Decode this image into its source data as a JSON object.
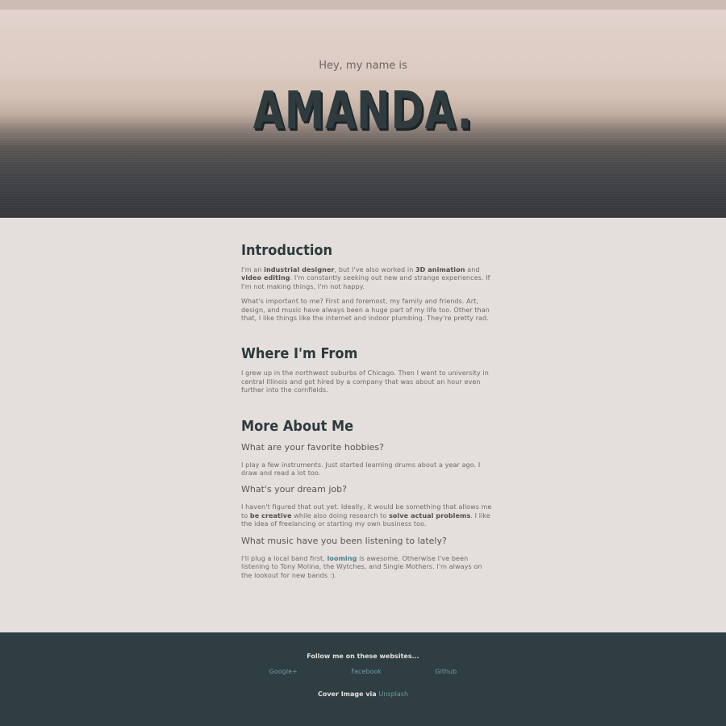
{
  "hero": {
    "greeting": "Hey, my name is",
    "name": "AMANDA."
  },
  "intro": {
    "title": "Introduction",
    "p1": {
      "t1": "I'm an ",
      "b1": "industrial designer",
      "t2": ", but I've also worked in ",
      "b2": "3D animation",
      "t3": " and ",
      "b3": "video editing",
      "t4": ". I'm constantly seeking out new and strange experiences. If I'm not making things, I'm not happy."
    },
    "p2": "What's important to me? First and foremost, my family and friends. Art, design, and music have always been a huge part of my life too. Other than that, I like things like the internet and indoor plumbing. They're pretty rad."
  },
  "from": {
    "title": "Where I'm From",
    "p1": "I grew up in the northwest suburbs of Chicago. Then I went to university in central Illinois and got hired by a company that was about an hour even further into the cornfields."
  },
  "more": {
    "title": "More About Me",
    "q1": "What are your favorite hobbies?",
    "a1": "I play a few instruments. Just started learning drums about a year ago. I draw and read a lot too.",
    "q2": "What's your dream job?",
    "a2": {
      "t1": "I haven't figured that out yet. Ideally, it would be something that allows me to ",
      "b1": "be creative",
      "t2": " while also doing research to ",
      "b2": "solve actual problems",
      "t3": ". I like the idea of freelancing or starting my own business too."
    },
    "q3": "What music have you been listening to lately?",
    "a3": {
      "t1": "I'll plug a local band first, ",
      "link": "looming",
      "t2": " is awesome. Otherwise I've been listening to Tony Molina, the Wytches, and Single Mothers. I'm always on the lookout for new bands :)."
    }
  },
  "footer": {
    "follow": "Follow me on these websites...",
    "links": [
      "Google+",
      "Facebook",
      "Github"
    ],
    "credit_prefix": "Cover Image via ",
    "credit_link": "Unsplash"
  }
}
